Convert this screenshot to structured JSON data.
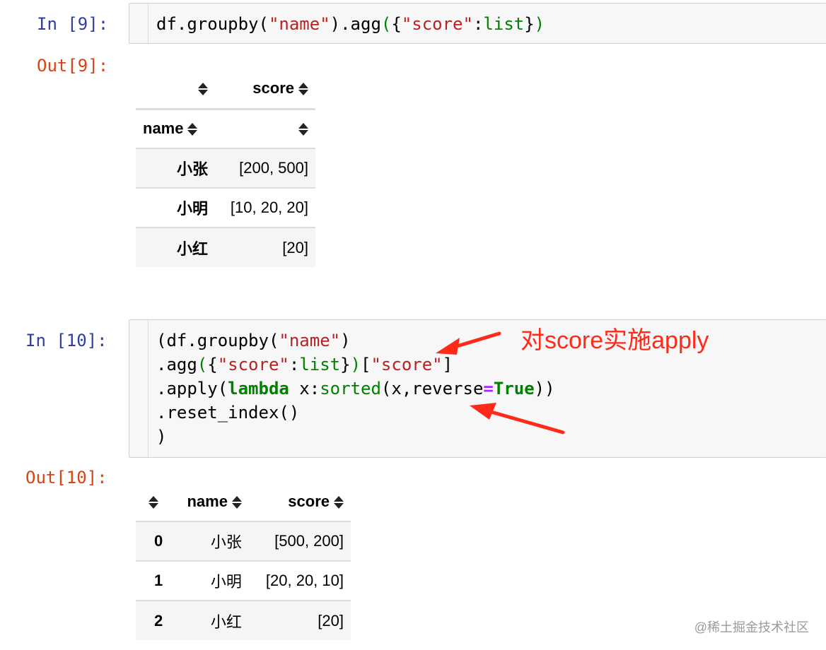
{
  "cells": [
    {
      "in_prompt": "In [9]:",
      "out_prompt": "Out[9]:",
      "code_tokens": [
        [
          {
            "t": "df.groupby(",
            "c": ""
          },
          {
            "t": "\"name\"",
            "c": "s"
          },
          {
            "t": ").agg",
            "c": ""
          },
          {
            "t": "(",
            "c": "g"
          },
          {
            "t": "{",
            "c": ""
          },
          {
            "t": "\"score\"",
            "c": "s"
          },
          {
            "t": ":",
            "c": ""
          },
          {
            "t": "list",
            "c": "g"
          },
          {
            "t": "}",
            "c": ""
          },
          {
            "t": ")",
            "c": "g"
          }
        ]
      ],
      "table": {
        "header_row1": [
          "",
          "score"
        ],
        "header_row2": [
          "name",
          ""
        ],
        "rows": [
          {
            "index": "小张",
            "score": "[200, 500]"
          },
          {
            "index": "小明",
            "score": "[10, 20, 20]"
          },
          {
            "index": "小红",
            "score": "[20]"
          }
        ]
      }
    },
    {
      "in_prompt": "In [10]:",
      "out_prompt": "Out[10]:",
      "code_tokens": [
        [
          {
            "t": "(df.groupby(",
            "c": ""
          },
          {
            "t": "\"name\"",
            "c": "s"
          },
          {
            "t": ")",
            "c": ""
          }
        ],
        [
          {
            "t": ".agg",
            "c": ""
          },
          {
            "t": "(",
            "c": "g"
          },
          {
            "t": "{",
            "c": ""
          },
          {
            "t": "\"score\"",
            "c": "s"
          },
          {
            "t": ":",
            "c": ""
          },
          {
            "t": "list",
            "c": "g"
          },
          {
            "t": "}",
            "c": ""
          },
          {
            "t": ")",
            "c": "g"
          },
          {
            "t": "[",
            "c": ""
          },
          {
            "t": "\"score\"",
            "c": "s"
          },
          {
            "t": "]",
            "c": ""
          }
        ],
        [
          {
            "t": ".apply(",
            "c": ""
          },
          {
            "t": "lambda",
            "c": "gb"
          },
          {
            "t": " x:",
            "c": ""
          },
          {
            "t": "sorted",
            "c": "g"
          },
          {
            "t": "(x,reverse",
            "c": ""
          },
          {
            "t": "=",
            "c": "op"
          },
          {
            "t": "True",
            "c": "gb"
          },
          {
            "t": "))",
            "c": ""
          }
        ],
        [
          {
            "t": ".reset_index()",
            "c": ""
          }
        ],
        [
          {
            "t": ")",
            "c": ""
          }
        ]
      ],
      "table": {
        "columns": [
          "",
          "name",
          "score"
        ],
        "rows": [
          {
            "index": "0",
            "name": "小张",
            "score": "[500, 200]"
          },
          {
            "index": "1",
            "name": "小明",
            "score": "[20, 20, 10]"
          },
          {
            "index": "2",
            "name": "小红",
            "score": "[20]"
          }
        ]
      }
    }
  ],
  "annotation": {
    "text": "对score实施apply",
    "color": "#ff2a1a"
  },
  "watermark": "@稀土掘金技术社区",
  "colors": {
    "in_prompt": "#303f9f",
    "out_prompt": "#d84315",
    "string": "#ba2121",
    "builtin": "#008000"
  }
}
